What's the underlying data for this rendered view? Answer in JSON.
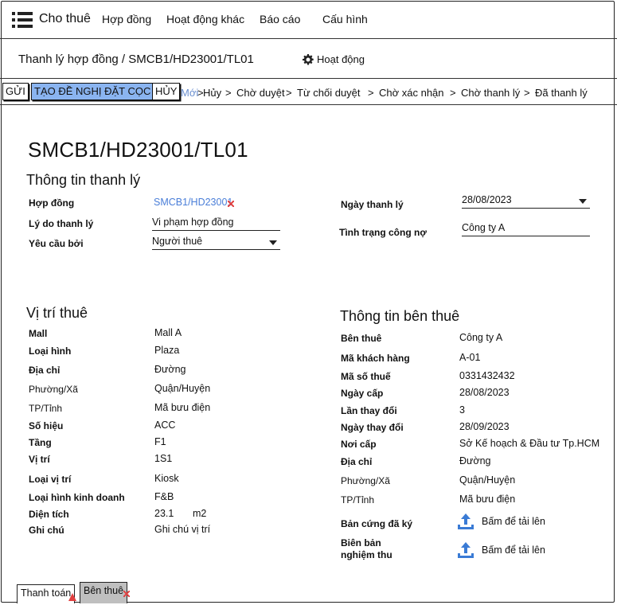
{
  "nav": {
    "brand": "Cho thuê",
    "items": [
      "Hợp đồng",
      "Hoạt động khác",
      "Báo cáo",
      "Cấu hình"
    ]
  },
  "breadcrumb": {
    "path": "Thanh lý hợp đồng / SMCB1/HD23001/TL01",
    "activity": "Hoạt động"
  },
  "actions": {
    "send": "GỬI",
    "deposit": "TẠO ĐỀ NGHỊ ĐẶT CỌC",
    "cancel": "HỦY"
  },
  "stages": [
    "Mới",
    "Hủy",
    "Chờ duyệt",
    "Từ chối duyệt",
    "Chờ xác nhận",
    "Chờ thanh lý",
    "Đã thanh lý"
  ],
  "stage_separator": ">",
  "record_title": "SMCB1/HD23001/TL01",
  "liquidation": {
    "heading": "Thông tin thanh lý",
    "contract_label": "Hợp đồng",
    "contract_value": "SMCB1/HD23001",
    "reason_label": "Lý do thanh lý",
    "reason_value": "Vi phạm hợp đồng",
    "requested_by_label": "Yêu cầu bởi",
    "requested_by_value": "Người thuê",
    "date_label": "Ngày thanh lý",
    "date_value": "28/08/2023",
    "debt_label": "Tình trạng công nợ",
    "debt_value": "Công ty A"
  },
  "location": {
    "heading": "Vị trí thuê",
    "rows": [
      {
        "label": "Mall",
        "value": "Mall A",
        "bold": true
      },
      {
        "label": "Loại hình",
        "value": "Plaza",
        "bold": true
      },
      {
        "label": "Địa chỉ",
        "value": "Đường",
        "bold": true
      },
      {
        "label": "Phường/Xã",
        "value": "Quận/Huyện",
        "bold": false
      },
      {
        "label": "TP/Tỉnh",
        "value": "Mã bưu điện",
        "bold": false
      },
      {
        "label": "Số hiệu",
        "value": "ACC",
        "bold": true
      },
      {
        "label": "Tầng",
        "value": "F1",
        "bold": true
      },
      {
        "label": "Vị trí",
        "value": "1S1",
        "bold": true
      },
      {
        "label": "Loại vị trí",
        "value": "Kiosk",
        "bold": true
      },
      {
        "label": "Loại hình kinh doanh",
        "value": "F&B",
        "bold": true
      },
      {
        "label": "Diện tích",
        "value": "23.1",
        "bold": true
      },
      {
        "label": "Ghi chú",
        "value": "Ghi chú vị trí",
        "bold": true
      }
    ],
    "area_unit": "m2"
  },
  "tenant": {
    "heading": "Thông tin bên thuê",
    "rows": [
      {
        "label": "Bên thuê",
        "value": "Công ty A",
        "bold": true
      },
      {
        "label": "Mã khách hàng",
        "value": "A-01",
        "bold": true
      },
      {
        "label": "Mã số thuế",
        "value": "0331432432",
        "bold": true
      },
      {
        "label": "Ngày cấp",
        "value": "28/08/2023",
        "bold": true
      },
      {
        "label": "Lần thay đổi",
        "value": "3",
        "bold": true
      },
      {
        "label": "Ngày thay đổi",
        "value": "28/09/2023",
        "bold": true
      },
      {
        "label": "Nơi cấp",
        "value": "Sở Kế hoạch & Đầu tư Tp.HCM",
        "bold": true
      },
      {
        "label": "Địa chỉ",
        "value": "Đường",
        "bold": true
      },
      {
        "label": "Phường/Xã",
        "value": "Quận/Huyện",
        "bold": false
      },
      {
        "label": "TP/Tỉnh",
        "value": "Mã bưu điện",
        "bold": false
      }
    ],
    "signed_copy_label": "Bản cứng đã ký",
    "acceptance_label_1": "Biên bản",
    "acceptance_label_2": "nghiệm thu",
    "upload_text": "Bấm để tải lên"
  },
  "tabs": [
    "Thanh toán",
    "Bên thuê"
  ],
  "colors": {
    "accent": "#8ab4f0",
    "link": "#4a7ed8",
    "upload": "#3a7bd5",
    "flag": "#e04040"
  }
}
